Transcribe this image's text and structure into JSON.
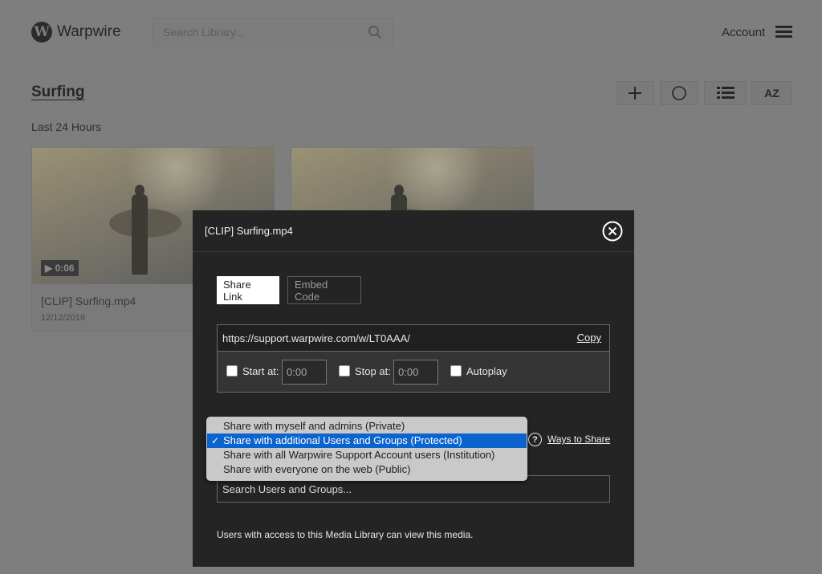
{
  "header": {
    "brand": "Warpwire",
    "logo_letter": "W",
    "search_placeholder": "Search Library...",
    "account_label": "Account"
  },
  "library": {
    "title": "Surfing",
    "period_label": "Last 24 Hours",
    "toolbar": {
      "add_icon": "plus-icon",
      "circle_icon": "circle-icon",
      "list_icon": "list-view-icon",
      "sort_label": "AZ"
    },
    "cards": [
      {
        "title": "[CLIP] Surfing.mp4",
        "date": "12/12/2019",
        "duration": "▶ 0:06"
      },
      {
        "title": "",
        "date": "",
        "duration": ""
      }
    ]
  },
  "modal": {
    "title": "[CLIP] Surfing.mp4",
    "tabs": [
      {
        "label": "Share Link",
        "active": true
      },
      {
        "label": "Embed Code",
        "active": false
      }
    ],
    "share_url": "https://support.warpwire.com/w/LT0AAA/",
    "copy_label": "Copy",
    "options": {
      "start_label": "Start at:",
      "start_value": "0:00",
      "stop_label": "Stop at:",
      "stop_value": "0:00",
      "autoplay_label": "Autoplay"
    },
    "ways_to_share_label": "Ways to Share",
    "users_search_placeholder": "Search Users and Groups...",
    "footer_note": "Users with access to this Media Library can view this media."
  },
  "share_dropdown": {
    "options": [
      {
        "label": "Share with myself and admins (Private)",
        "selected": false
      },
      {
        "label": "Share with additional Users and Groups (Protected)",
        "selected": true
      },
      {
        "label": "Share with all Warpwire Support Account users (Institution)",
        "selected": false
      },
      {
        "label": "Share with everyone on the web (Public)",
        "selected": false
      }
    ],
    "check_mark": "✓"
  },
  "colors": {
    "overlay_gray": "#7e7e7e",
    "modal_bg": "#242424",
    "selected_blue": "#0b63ce",
    "dropdown_bg": "#c9c9c9"
  }
}
